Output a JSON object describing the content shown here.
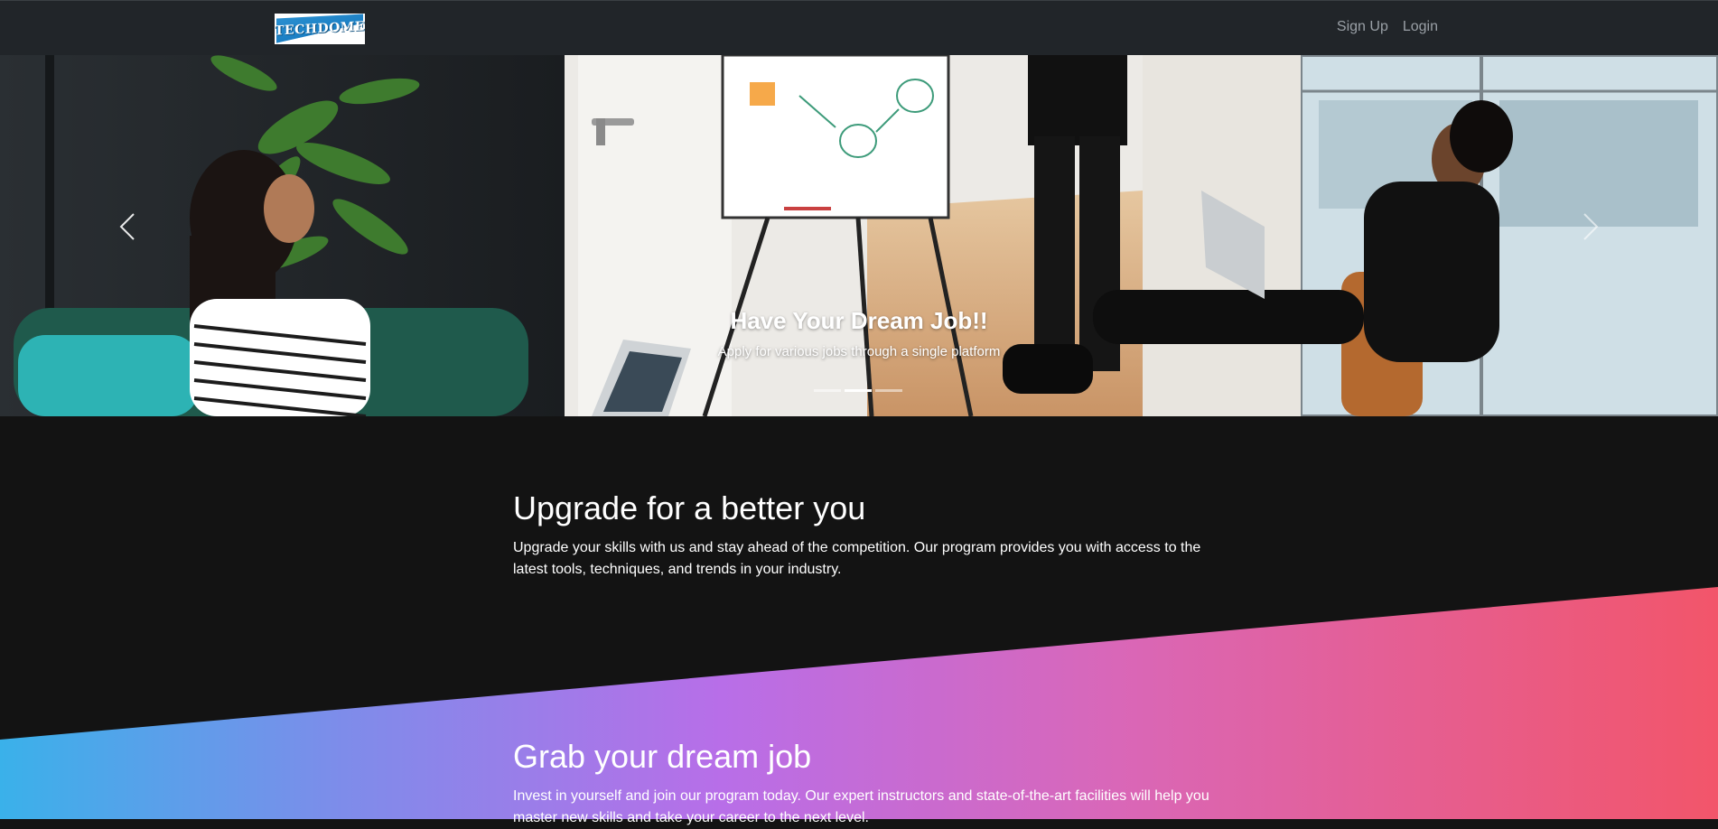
{
  "navbar": {
    "brand": "TECHDOME",
    "links": [
      {
        "label": "Sign Up"
      },
      {
        "label": "Login"
      }
    ]
  },
  "hero": {
    "title": "Have Your Dream Job!!",
    "subtitle": "Apply for various jobs through a single platform",
    "slide_count": 3,
    "active_slide": 2
  },
  "upgrade": {
    "title": "Upgrade for a better you",
    "text": "Upgrade your skills with us and stay ahead of the competition. Our program provides you with access to the latest tools, techniques, and trends in your industry."
  },
  "grab": {
    "title": "Grab your dream job",
    "text": "Invest in yourself and join our program today. Our expert instructors and state-of-the-art facilities will help you master new skills and take your career to the next level."
  },
  "colors": {
    "navbar": "#212529",
    "background": "#131313",
    "gradient": [
      "#3ab1ea",
      "#b86ee8",
      "#f2556a"
    ]
  }
}
